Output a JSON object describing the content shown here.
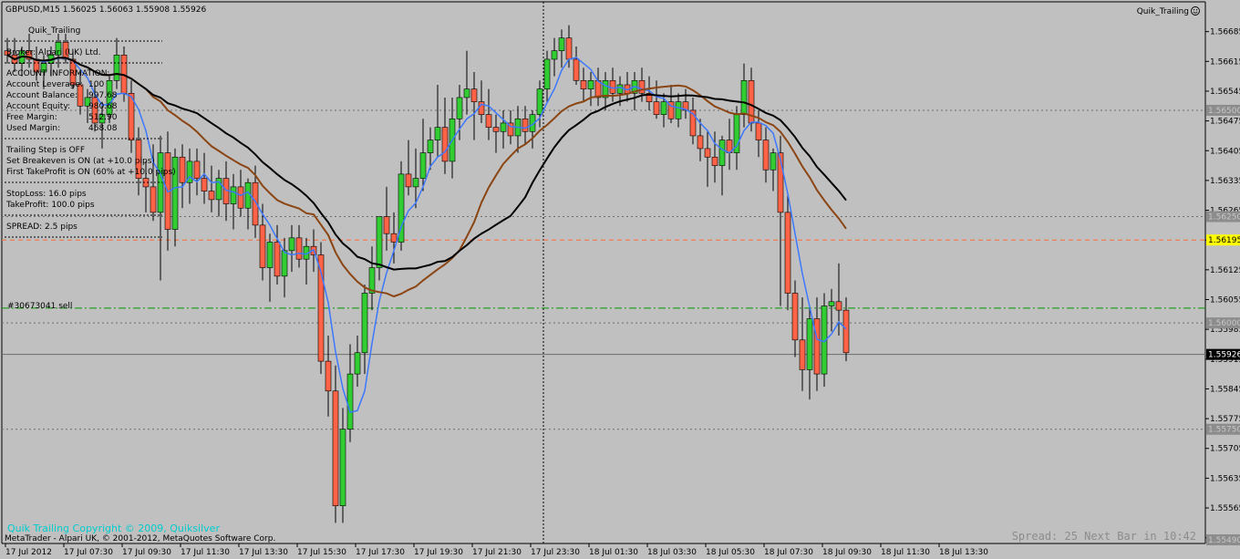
{
  "header": {
    "symbol_line": "GBPUSD,M15  1.56025 1.56063 1.55908 1.55926",
    "ea_name": "Quik_Trailing",
    "smiley_icon": "smiley-icon"
  },
  "info_panel": {
    "title": "Quik_Trailing",
    "broker": "Broker:  Alpari (UK) Ltd.",
    "account_header": "ACCOUNT INFORMATION:",
    "rows": [
      {
        "label": "Account Leverage:",
        "value": "100"
      },
      {
        "label": "Account Balance:",
        "value": "997.68"
      },
      {
        "label": "Account Equity:",
        "value": "980.68"
      },
      {
        "label": "Free Margin:",
        "value": "512.90"
      },
      {
        "label": "Used Margin:",
        "value": "468.08"
      }
    ],
    "trailing_lines": [
      "Trailing Step is OFF",
      "Set Breakeven is ON (at +10.0 pips)",
      "First TakeProfit is ON (60% at +10.0 pips)"
    ],
    "stoploss": "StopLoss: 16.0 pips",
    "takeprofit": "TakeProfit: 100.0 pips",
    "spread": "SPREAD:  2.5  pips"
  },
  "order_label": "#30673041 sell",
  "footer": {
    "copyright_ea": "Quik Trailing   Copyright © 2009, Quiksilver",
    "copyright_mt": "MetaTrader - Alpari UK, © 2001-2012, MetaQuotes Software Corp.",
    "spread_next_bar": "Spread: 25  Next Bar in 10:42"
  },
  "colors": {
    "background": "#c0c0c0",
    "bull": "#32cd32",
    "bear": "#ff6347",
    "ma_fast": "#3c78ff",
    "ma_mid": "#8b4513",
    "ma_slow": "#000000",
    "orange_line": "#ff6a33",
    "green_line": "#009900",
    "highlight_price": "#ffff00",
    "footer_text": "#00cccc"
  },
  "chart_data": {
    "type": "candlestick",
    "title": "GBPUSD,M15  1.56025 1.56063 1.55908 1.55926",
    "ylim": [
      1.5549,
      1.56695
    ],
    "y_ticks": [
      "1.56685",
      "1.56615",
      "1.56545",
      "1.56475",
      "1.56405",
      "1.56335",
      "1.56265",
      "1.56195",
      "1.56125",
      "1.56055",
      "1.55985",
      "1.55915",
      "1.55845",
      "1.55775",
      "1.55705",
      "1.55635",
      "1.55565",
      "1.55495"
    ],
    "price_boxes": [
      {
        "label": "1.56500",
        "value": 1.565,
        "style": "grey"
      },
      {
        "label": "1.56250",
        "value": 1.5625,
        "style": "grey"
      },
      {
        "label": "1.56195",
        "value": 1.56195,
        "style": "yellow"
      },
      {
        "label": "1.56000",
        "value": 1.56,
        "style": "grey"
      },
      {
        "label": "1.55926",
        "value": 1.55926,
        "style": "black"
      },
      {
        "label": "1.55750",
        "value": 1.5575,
        "style": "grey"
      },
      {
        "label": "1.55490",
        "value": 1.5549,
        "style": "grey"
      }
    ],
    "x_labels": [
      "17 Jul 2012",
      "17 Jul 07:30",
      "17 Jul 09:30",
      "17 Jul 11:30",
      "17 Jul 13:30",
      "17 Jul 15:30",
      "17 Jul 17:30",
      "17 Jul 19:30",
      "17 Jul 21:30",
      "17 Jul 23:30",
      "18 Jul 01:30",
      "18 Jul 03:30",
      "18 Jul 05:30",
      "18 Jul 07:30",
      "18 Jul 09:30",
      "18 Jul 11:30",
      "18 Jul 13:30"
    ],
    "hlines": [
      {
        "value": 1.565,
        "style": "dotted-grey"
      },
      {
        "value": 1.5625,
        "style": "dotted-grey"
      },
      {
        "value": 1.56195,
        "style": "dashed-orange"
      },
      {
        "value": 1.56035,
        "style": "dashdot-green"
      },
      {
        "value": 1.56,
        "style": "dotted-grey"
      },
      {
        "value": 1.55926,
        "style": "solid-grey"
      },
      {
        "value": 1.5575,
        "style": "dotted-grey"
      }
    ],
    "candles": [
      [
        1.5664,
        1.5667,
        1.5661,
        1.5663
      ],
      [
        1.5663,
        1.5667,
        1.5659,
        1.5661
      ],
      [
        1.5661,
        1.5665,
        1.5658,
        1.5664
      ],
      [
        1.5664,
        1.5668,
        1.566,
        1.5662
      ],
      [
        1.5662,
        1.5665,
        1.5657,
        1.5659
      ],
      [
        1.5659,
        1.5663,
        1.5655,
        1.5661
      ],
      [
        1.5661,
        1.5665,
        1.5658,
        1.5663
      ],
      [
        1.5663,
        1.5668,
        1.566,
        1.5666
      ],
      [
        1.5666,
        1.5668,
        1.5661,
        1.5662
      ],
      [
        1.5662,
        1.5664,
        1.5655,
        1.5656
      ],
      [
        1.5656,
        1.5659,
        1.5649,
        1.5651
      ],
      [
        1.5651,
        1.5655,
        1.5647,
        1.5653
      ],
      [
        1.5653,
        1.5656,
        1.5645,
        1.5647
      ],
      [
        1.5647,
        1.5652,
        1.5641,
        1.5649
      ],
      [
        1.5649,
        1.5658,
        1.5647,
        1.5657
      ],
      [
        1.5657,
        1.5667,
        1.5655,
        1.5663
      ],
      [
        1.5663,
        1.5665,
        1.5652,
        1.5654
      ],
      [
        1.5654,
        1.5657,
        1.564,
        1.5643
      ],
      [
        1.5643,
        1.5646,
        1.563,
        1.5634
      ],
      [
        1.5634,
        1.5638,
        1.5626,
        1.5632
      ],
      [
        1.5632,
        1.5642,
        1.5624,
        1.5626
      ],
      [
        1.5626,
        1.5644,
        1.561,
        1.564
      ],
      [
        1.564,
        1.5645,
        1.5617,
        1.5622
      ],
      [
        1.5622,
        1.5641,
        1.5618,
        1.5639
      ],
      [
        1.5639,
        1.5642,
        1.5627,
        1.5633
      ],
      [
        1.5633,
        1.5641,
        1.5628,
        1.5638
      ],
      [
        1.5638,
        1.5641,
        1.563,
        1.5634
      ],
      [
        1.5634,
        1.564,
        1.5628,
        1.5631
      ],
      [
        1.5631,
        1.5637,
        1.5626,
        1.5629
      ],
      [
        1.5629,
        1.5636,
        1.5625,
        1.5634
      ],
      [
        1.5634,
        1.5638,
        1.5624,
        1.5628
      ],
      [
        1.5628,
        1.5635,
        1.5622,
        1.5632
      ],
      [
        1.5632,
        1.5636,
        1.5625,
        1.5627
      ],
      [
        1.5627,
        1.5634,
        1.5622,
        1.5633
      ],
      [
        1.5633,
        1.5637,
        1.562,
        1.5623
      ],
      [
        1.5623,
        1.5628,
        1.561,
        1.5613
      ],
      [
        1.5613,
        1.5621,
        1.5605,
        1.5619
      ],
      [
        1.5619,
        1.5623,
        1.5609,
        1.5611
      ],
      [
        1.5611,
        1.562,
        1.5606,
        1.5617
      ],
      [
        1.5617,
        1.5623,
        1.5612,
        1.562
      ],
      [
        1.562,
        1.5623,
        1.5613,
        1.5615
      ],
      [
        1.5615,
        1.562,
        1.5609,
        1.5618
      ],
      [
        1.5618,
        1.5622,
        1.5612,
        1.5616
      ],
      [
        1.5616,
        1.5619,
        1.5588,
        1.5591
      ],
      [
        1.5591,
        1.5597,
        1.5578,
        1.5584
      ],
      [
        1.5584,
        1.559,
        1.5553,
        1.5557
      ],
      [
        1.5557,
        1.558,
        1.5553,
        1.5575
      ],
      [
        1.5575,
        1.5595,
        1.5572,
        1.5588
      ],
      [
        1.5588,
        1.5597,
        1.5585,
        1.5593
      ],
      [
        1.5593,
        1.5609,
        1.5588,
        1.5607
      ],
      [
        1.5607,
        1.5618,
        1.5603,
        1.5613
      ],
      [
        1.5613,
        1.5623,
        1.561,
        1.5625
      ],
      [
        1.5625,
        1.5632,
        1.5617,
        1.5621
      ],
      [
        1.5621,
        1.5626,
        1.5614,
        1.5619
      ],
      [
        1.5619,
        1.5638,
        1.5617,
        1.5635
      ],
      [
        1.5635,
        1.5643,
        1.563,
        1.5632
      ],
      [
        1.5632,
        1.5641,
        1.5627,
        1.5634
      ],
      [
        1.5634,
        1.5648,
        1.5631,
        1.564
      ],
      [
        1.564,
        1.5646,
        1.5636,
        1.5643
      ],
      [
        1.5643,
        1.5656,
        1.5639,
        1.5646
      ],
      [
        1.5646,
        1.5653,
        1.5635,
        1.5638
      ],
      [
        1.5638,
        1.5653,
        1.5634,
        1.5648
      ],
      [
        1.5648,
        1.5656,
        1.5643,
        1.5653
      ],
      [
        1.5653,
        1.5664,
        1.5649,
        1.5655
      ],
      [
        1.5655,
        1.5659,
        1.5643,
        1.5652
      ],
      [
        1.5652,
        1.5657,
        1.5647,
        1.5649
      ],
      [
        1.5649,
        1.5655,
        1.5643,
        1.5646
      ],
      [
        1.5646,
        1.5649,
        1.564,
        1.5645
      ],
      [
        1.5645,
        1.565,
        1.5641,
        1.5647
      ],
      [
        1.5647,
        1.565,
        1.5642,
        1.5644
      ],
      [
        1.5644,
        1.5651,
        1.564,
        1.5648
      ],
      [
        1.5648,
        1.5651,
        1.5642,
        1.5645
      ],
      [
        1.5645,
        1.565,
        1.5641,
        1.5649
      ],
      [
        1.5649,
        1.5657,
        1.5646,
        1.5655
      ],
      [
        1.5655,
        1.5664,
        1.5652,
        1.5662
      ],
      [
        1.5662,
        1.5667,
        1.5658,
        1.5664
      ],
      [
        1.5664,
        1.5669,
        1.566,
        1.5667
      ],
      [
        1.5667,
        1.567,
        1.566,
        1.5662
      ],
      [
        1.5662,
        1.5665,
        1.5656,
        1.5657
      ],
      [
        1.5657,
        1.566,
        1.5652,
        1.5655
      ],
      [
        1.5655,
        1.5659,
        1.5651,
        1.5657
      ],
      [
        1.5657,
        1.566,
        1.5651,
        1.5653
      ],
      [
        1.5653,
        1.5659,
        1.565,
        1.5657
      ],
      [
        1.5657,
        1.566,
        1.5652,
        1.5654
      ],
      [
        1.5654,
        1.5658,
        1.5651,
        1.5656
      ],
      [
        1.5656,
        1.5659,
        1.5652,
        1.5654
      ],
      [
        1.5654,
        1.5659,
        1.565,
        1.5657
      ],
      [
        1.5657,
        1.566,
        1.5652,
        1.5654
      ],
      [
        1.5654,
        1.5658,
        1.565,
        1.5652
      ],
      [
        1.5652,
        1.5657,
        1.5648,
        1.5649
      ],
      [
        1.5649,
        1.5654,
        1.5646,
        1.5652
      ],
      [
        1.5652,
        1.5656,
        1.5647,
        1.5648
      ],
      [
        1.5648,
        1.5654,
        1.5646,
        1.5652
      ],
      [
        1.5652,
        1.5655,
        1.5648,
        1.565
      ],
      [
        1.565,
        1.5653,
        1.5642,
        1.5644
      ],
      [
        1.5644,
        1.5648,
        1.5638,
        1.5641
      ],
      [
        1.5641,
        1.5645,
        1.5632,
        1.5639
      ],
      [
        1.5639,
        1.5645,
        1.5633,
        1.5637
      ],
      [
        1.5637,
        1.5644,
        1.563,
        1.5643
      ],
      [
        1.5643,
        1.5648,
        1.5636,
        1.564
      ],
      [
        1.564,
        1.5651,
        1.5636,
        1.5649
      ],
      [
        1.5649,
        1.5661,
        1.5646,
        1.5657
      ],
      [
        1.5657,
        1.566,
        1.5645,
        1.5647
      ],
      [
        1.5647,
        1.565,
        1.5639,
        1.5643
      ],
      [
        1.5643,
        1.5646,
        1.5633,
        1.5636
      ],
      [
        1.5636,
        1.5641,
        1.5631,
        1.564
      ],
      [
        1.564,
        1.5644,
        1.5604,
        1.5626
      ],
      [
        1.5626,
        1.563,
        1.5603,
        1.5607
      ],
      [
        1.5607,
        1.561,
        1.5592,
        1.5596
      ],
      [
        1.5596,
        1.5606,
        1.5584,
        1.5589
      ],
      [
        1.5589,
        1.5604,
        1.5582,
        1.5601
      ],
      [
        1.5601,
        1.5606,
        1.5584,
        1.5588
      ],
      [
        1.5588,
        1.5607,
        1.5585,
        1.5604
      ],
      [
        1.5604,
        1.5608,
        1.5598,
        1.5605
      ],
      [
        1.5605,
        1.5614,
        1.5597,
        1.5603
      ],
      [
        1.5603,
        1.5606,
        1.5591,
        1.5593
      ]
    ],
    "series": [
      {
        "name": "",
        "color": "#3c78ff"
      },
      {
        "name": "",
        "color": "#8b4513"
      },
      {
        "name": "",
        "color": "#000000"
      }
    ]
  }
}
